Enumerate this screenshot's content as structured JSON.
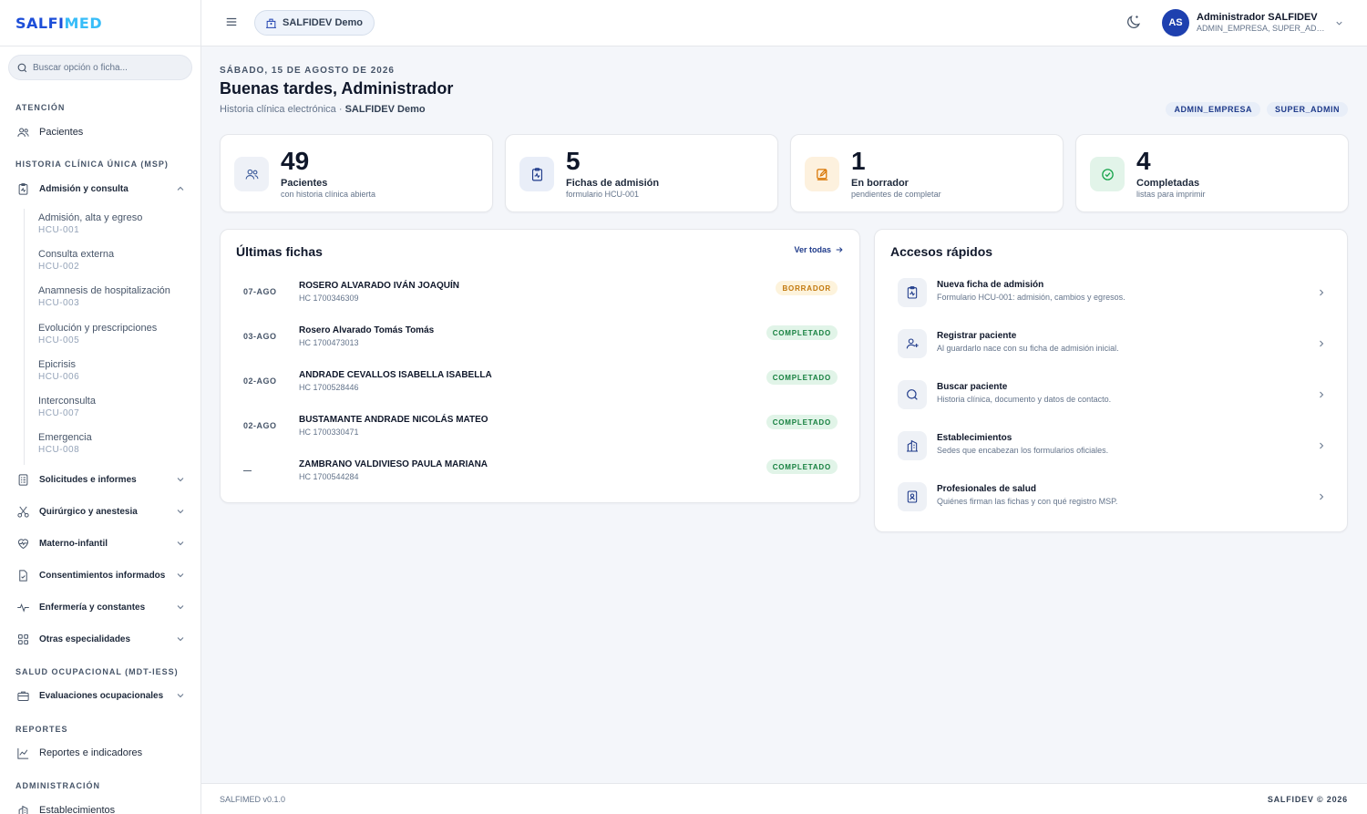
{
  "brand": {
    "logo_main": "SALFI",
    "logo_accent": "MED"
  },
  "search": {
    "placeholder": "Buscar opción o ficha..."
  },
  "sidebar": {
    "sections": {
      "atencion": "ATENCIÓN",
      "hcu": "HISTORIA CLÍNICA ÚNICA (MSP)",
      "salud_ocupacional": "SALUD OCUPACIONAL (MDT-IESS)",
      "reportes": "REPORTES",
      "administracion": "ADMINISTRACIÓN"
    },
    "pacientes": "Pacientes",
    "admision": {
      "label": "Admisión y consulta",
      "items": [
        {
          "title": "Admisión, alta y egreso",
          "code": "HCU-001"
        },
        {
          "title": "Consulta externa",
          "code": "HCU-002"
        },
        {
          "title": "Anamnesis de hospitalización",
          "code": "HCU-003"
        },
        {
          "title": "Evolución y prescripciones",
          "code": "HCU-005"
        },
        {
          "title": "Epicrisis",
          "code": "HCU-006"
        },
        {
          "title": "Interconsulta",
          "code": "HCU-007"
        },
        {
          "title": "Emergencia",
          "code": "HCU-008"
        }
      ]
    },
    "groups": {
      "solicitudes": "Solicitudes e informes",
      "quirurgico": "Quirúrgico y anestesia",
      "materno": "Materno-infantil",
      "consentimientos": "Consentimientos informados",
      "enfermeria": "Enfermería y constantes",
      "otras": "Otras especialidades",
      "evaluaciones": "Evaluaciones ocupacionales"
    },
    "reportes_item": "Reportes e indicadores",
    "establecimientos_item": "Establecimientos"
  },
  "topbar": {
    "tenant": "SALFIDEV Demo",
    "avatar_initials": "AS",
    "user_name": "Administrador SALFIDEV",
    "user_roles": "ADMIN_EMPRESA, SUPER_ADMIN"
  },
  "header": {
    "date": "SÁBADO, 15 DE AGOSTO DE 2026",
    "greeting": "Buenas tardes, Administrador",
    "subtitle_prefix": "Historia clínica electrónica ·",
    "subtitle_tenant": "SALFIDEV Demo",
    "roles": [
      "ADMIN_EMPRESA",
      "SUPER_ADMIN"
    ]
  },
  "stats": [
    {
      "value": "49",
      "label": "Pacientes",
      "desc": "con historia clínica abierta",
      "icon": "users-icon",
      "color": "#3b5a9a"
    },
    {
      "value": "5",
      "label": "Fichas de admisión",
      "desc": "formulario HCU-001",
      "icon": "clipboard-icon",
      "color": "#1e3a8a"
    },
    {
      "value": "1",
      "label": "En borrador",
      "desc": "pendientes de completar",
      "icon": "edit-icon",
      "color": "#d97706"
    },
    {
      "value": "4",
      "label": "Completadas",
      "desc": "listas para imprimir",
      "icon": "check-circle-icon",
      "color": "#16a34a"
    }
  ],
  "ultimas": {
    "title": "Últimas fichas",
    "see_all": "Ver todas",
    "rows": [
      {
        "date": "07-AGO",
        "name": "ROSERO ALVARADO IVÁN JOAQUÍN",
        "hc": "HC 1700346309",
        "status": "BORRADOR",
        "kind": "draft"
      },
      {
        "date": "03-AGO",
        "name": "Rosero Alvarado Tomás Tomás",
        "hc": "HC 1700473013",
        "status": "COMPLETADO",
        "kind": "done"
      },
      {
        "date": "02-AGO",
        "name": "ANDRADE CEVALLOS ISABELLA ISABELLA",
        "hc": "HC 1700528446",
        "status": "COMPLETADO",
        "kind": "done"
      },
      {
        "date": "02-AGO",
        "name": "BUSTAMANTE ANDRADE NICOLÁS MATEO",
        "hc": "HC 1700330471",
        "status": "COMPLETADO",
        "kind": "done"
      },
      {
        "date": "—",
        "name": "ZAMBRANO VALDIVIESO PAULA MARIANA",
        "hc": "HC 1700544284",
        "status": "COMPLETADO",
        "kind": "done"
      }
    ]
  },
  "accesos": {
    "title": "Accesos rápidos",
    "items": [
      {
        "title": "Nueva ficha de admisión",
        "desc": "Formulario HCU-001: admisión, cambios y egresos.",
        "icon": "clipboard-icon"
      },
      {
        "title": "Registrar paciente",
        "desc": "Al guardarlo nace con su ficha de admisión inicial.",
        "icon": "user-plus-icon"
      },
      {
        "title": "Buscar paciente",
        "desc": "Historia clínica, documento y datos de contacto.",
        "icon": "search-icon"
      },
      {
        "title": "Establecimientos",
        "desc": "Sedes que encabezan los formularios oficiales.",
        "icon": "building-icon"
      },
      {
        "title": "Profesionales de salud",
        "desc": "Quiénes firman las fichas y con qué registro MSP.",
        "icon": "badge-icon"
      }
    ]
  },
  "footer": {
    "version": "SALFIMED v0.1.0",
    "copyright": "SALFIDEV © 2026"
  }
}
